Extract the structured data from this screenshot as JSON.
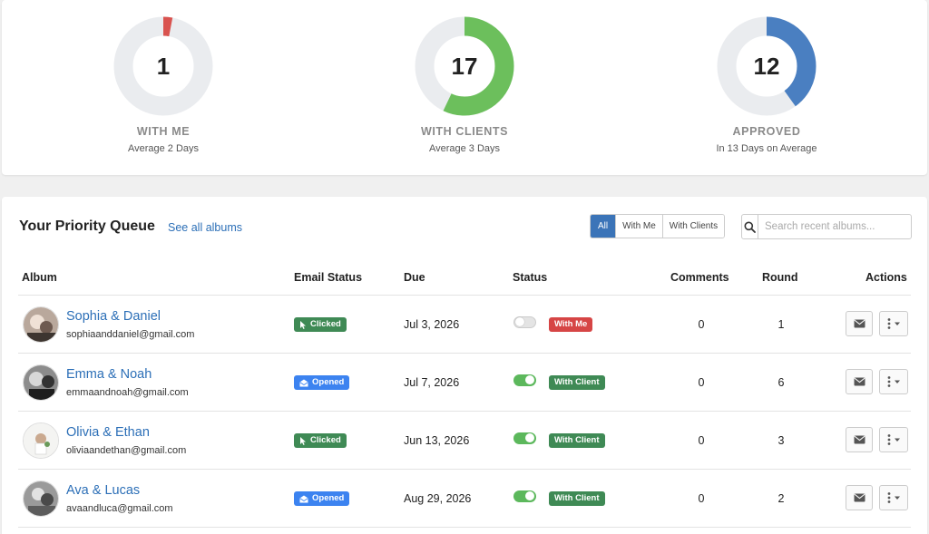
{
  "stats": [
    {
      "value": "1",
      "title": "WITH ME",
      "subtitle": "Average 2 Days",
      "fraction": 0.03,
      "color": "#d9534f"
    },
    {
      "value": "17",
      "title": "WITH CLIENTS",
      "subtitle": "Average 3 Days",
      "fraction": 0.57,
      "color": "#6cbf5c"
    },
    {
      "value": "12",
      "title": "APPROVED",
      "subtitle": "In 13 Days on Average",
      "fraction": 0.4,
      "color": "#4a7fc1"
    }
  ],
  "queue": {
    "title": "Your Priority Queue",
    "see_all": "See all albums",
    "filters": [
      "All",
      "With Me",
      "With Clients"
    ],
    "active_filter": "All",
    "search_placeholder": "Search recent albums..."
  },
  "columns": {
    "album": "Album",
    "email_status": "Email Status",
    "due": "Due",
    "status": "Status",
    "comments": "Comments",
    "round": "Round",
    "actions": "Actions"
  },
  "rows": [
    {
      "name": "Sophia & Daniel",
      "email": "sophiaanddaniel@gmail.com",
      "email_status": "Clicked",
      "email_icon": "cursor-icon",
      "due": "Jul 3, 2026",
      "toggle_on": false,
      "status": "With Me",
      "status_color": "red",
      "comments": "0",
      "round": "1"
    },
    {
      "name": "Emma & Noah",
      "email": "emmaandnoah@gmail.com",
      "email_status": "Opened",
      "email_icon": "envelope-open-icon",
      "due": "Jul 7, 2026",
      "toggle_on": true,
      "status": "With Client",
      "status_color": "green",
      "comments": "0",
      "round": "6"
    },
    {
      "name": "Olivia & Ethan",
      "email": "oliviaandethan@gmail.com",
      "email_status": "Clicked",
      "email_icon": "cursor-icon",
      "due": "Jun 13, 2026",
      "toggle_on": true,
      "status": "With Client",
      "status_color": "green",
      "comments": "0",
      "round": "3"
    },
    {
      "name": "Ava & Lucas",
      "email": "avaandluca@gmail.com",
      "email_status": "Opened",
      "email_icon": "envelope-open-icon",
      "due": "Aug 29, 2026",
      "toggle_on": true,
      "status": "With Client",
      "status_color": "green",
      "comments": "0",
      "round": "2"
    }
  ]
}
